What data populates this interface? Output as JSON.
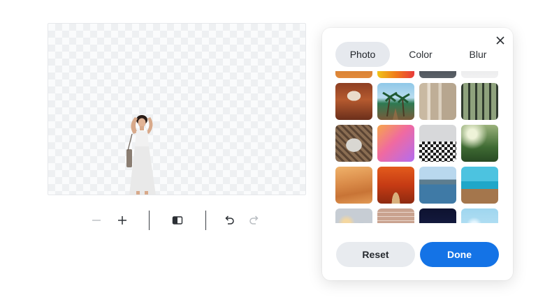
{
  "editor": {
    "toolbar": {
      "zoom_out_icon": "minus-icon",
      "zoom_in_icon": "plus-icon",
      "compare_icon": "split-view-icon",
      "undo_icon": "undo-icon",
      "redo_icon": "redo-icon"
    }
  },
  "panel": {
    "tabs": [
      {
        "label": "Photo",
        "active": true
      },
      {
        "label": "Color",
        "active": false
      },
      {
        "label": "Blur",
        "active": false
      }
    ],
    "close_icon": "close-icon",
    "photos": [
      "orange-dunes",
      "yellow-gradient",
      "dark-landscape",
      "light-gray",
      "canyon-arch",
      "palm-beach-pier",
      "stone-columns",
      "greenhouse",
      "wooden-pavilion",
      "pink-gradient",
      "checkered-hall",
      "jungle-light",
      "desert-sand",
      "autumn-path",
      "mountain-lake",
      "tropical-pier",
      "bokeh-lights",
      "brick-wall",
      "dark-blue-sparkle",
      "blue-bokeh"
    ],
    "reset_label": "Reset",
    "done_label": "Done"
  },
  "colors": {
    "accent": "#1473e6",
    "tab_active_bg": "#e6e9ee",
    "reset_bg": "#e8ebef"
  }
}
